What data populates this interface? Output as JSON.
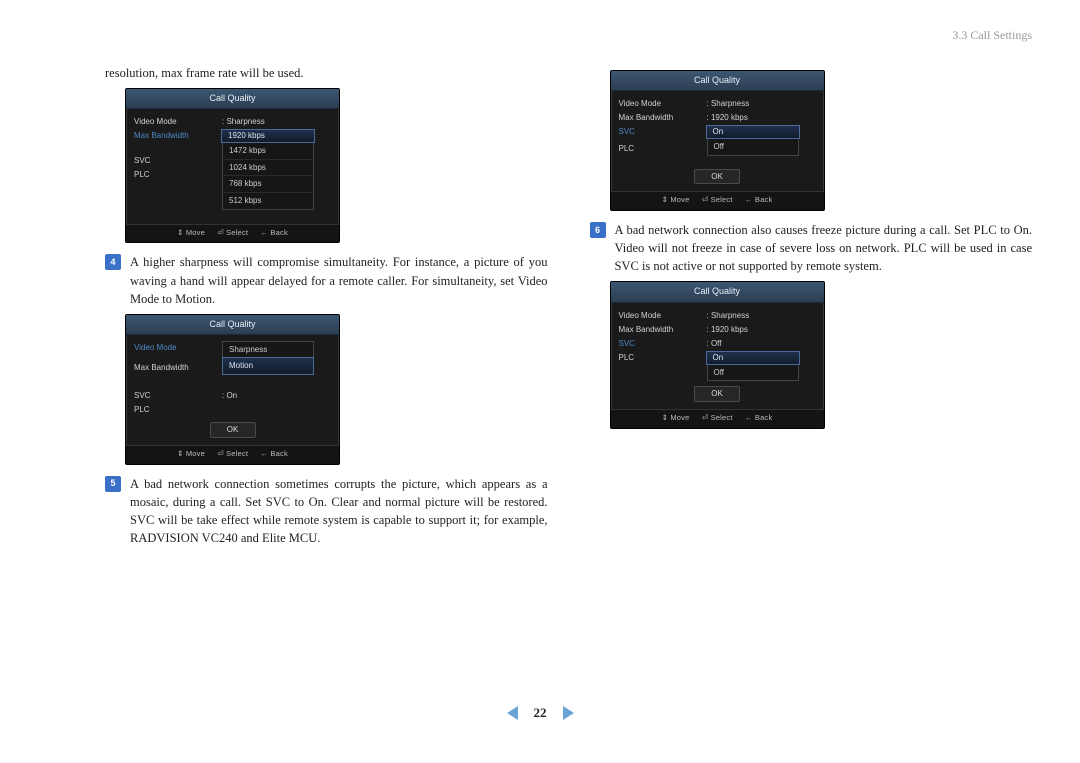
{
  "header": {
    "section": "3.3 Call Settings"
  },
  "col1": {
    "continuation": "resolution, max frame rate will be used.",
    "step4": {
      "n": "4",
      "text": "A higher sharpness will compromise simultaneity. For instance, a picture of you waving a hand will appear delayed for a remote caller. For simultaneity, set Video Mode to Motion."
    },
    "step5": {
      "n": "5",
      "text": "A bad network connection sometimes corrupts the picture, which appears as a mosaic, during a call. Set SVC to On. Clear and normal picture will be restored. SVC will be take effect while remote system is capable to support it; for example, RADVISION VC240 and Elite MCU."
    }
  },
  "col2": {
    "step6": {
      "n": "6",
      "text": "A bad network connection also causes freeze picture during a call. Set PLC to On. Video will not freeze in case of severe loss on network. PLC will be used in case SVC is not active or not supported by remote system."
    }
  },
  "dialogs": {
    "title": "Call Quality",
    "labels": {
      "video_mode": "Video Mode",
      "max_bw": "Max Bandwidth",
      "svc": "SVC",
      "plc": "PLC"
    },
    "ok": "OK",
    "footer": {
      "move": "⇕ Move",
      "select": "⏎ Select",
      "back": "← Back"
    },
    "bw": {
      "rows": [
        {
          "k": "Video Mode",
          "v": ": Sharpness",
          "active": false
        },
        {
          "k": "Max Bandwidth",
          "v": "",
          "active": true
        },
        {
          "k": "SVC",
          "v": "",
          "active": false
        },
        {
          "k": "PLC",
          "v": "",
          "active": false
        }
      ],
      "options": [
        "1920 kbps",
        "1472 kbps",
        "1024 kbps",
        "768 kbps",
        "512 kbps"
      ],
      "selected": 0
    },
    "vm": {
      "rows": [
        {
          "k": "Video Mode",
          "v": "",
          "active": true
        },
        {
          "k": "Max Bandwidth",
          "v": "",
          "active": false
        },
        {
          "k": "SVC",
          "v": ": On",
          "active": false
        },
        {
          "k": "PLC",
          "v": "",
          "active": false
        }
      ],
      "options": [
        "Sharpness",
        "Motion"
      ],
      "selected": 1
    },
    "svc": {
      "rows": [
        {
          "k": "Video Mode",
          "v": ": Sharpness",
          "active": false
        },
        {
          "k": "Max Bandwidth",
          "v": ": 1920 kbps",
          "active": false
        },
        {
          "k": "SVC",
          "v": "",
          "active": true
        },
        {
          "k": "PLC",
          "v": "",
          "active": false
        }
      ],
      "options": [
        "On",
        "Off"
      ],
      "selected": 0
    },
    "plc": {
      "rows": [
        {
          "k": "Video Mode",
          "v": ": Sharpness",
          "active": false
        },
        {
          "k": "Max Bandwidth",
          "v": ": 1920 kbps",
          "active": false
        },
        {
          "k": "SVC",
          "v": ": Off",
          "active": true
        },
        {
          "k": "PLC",
          "v": "",
          "active": false
        }
      ],
      "options": [
        "On",
        "Off"
      ],
      "selected": 0
    }
  },
  "pager": {
    "page": "22"
  }
}
